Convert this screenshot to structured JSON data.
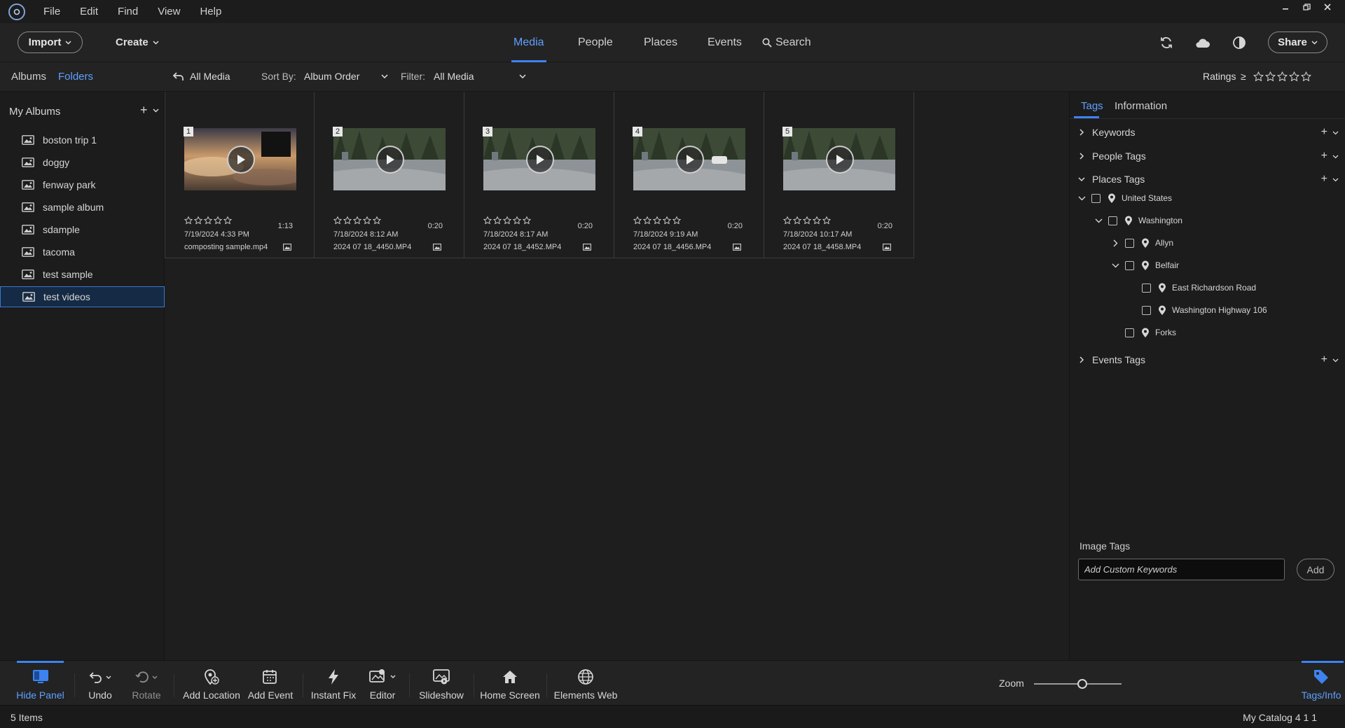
{
  "menu": {
    "items": [
      "File",
      "Edit",
      "Find",
      "View",
      "Help"
    ]
  },
  "toolbar": {
    "import_label": "Import",
    "create_label": "Create",
    "tabs": [
      "Media",
      "People",
      "Places",
      "Events"
    ],
    "active_tab": "Media",
    "search_label": "Search",
    "share_label": "Share"
  },
  "subbar": {
    "albums_tab": "Albums",
    "folders_tab": "Folders",
    "back_label": "All Media",
    "sort_label": "Sort By:",
    "sort_value": "Album Order",
    "filter_label": "Filter:",
    "filter_value": "All Media",
    "ratings_label": "Ratings",
    "ratings_op": "≥"
  },
  "sidebar": {
    "heading": "My Albums",
    "albums": [
      "boston trip 1",
      "doggy",
      "fenway park",
      "sample album",
      "sdample",
      "tacoma",
      "test sample",
      "test videos"
    ],
    "selected": "test videos"
  },
  "media": [
    {
      "index": "1",
      "date": "7/19/2024 4:33 PM",
      "duration": "1:13",
      "filename": "composting sample.mp4",
      "rating": 0
    },
    {
      "index": "2",
      "date": "7/18/2024 8:12 AM",
      "duration": "0:20",
      "filename": "2024 07 18_4450.MP4",
      "rating": 0
    },
    {
      "index": "3",
      "date": "7/18/2024 8:17 AM",
      "duration": "0:20",
      "filename": "2024 07 18_4452.MP4",
      "rating": 0
    },
    {
      "index": "4",
      "date": "7/18/2024 9:19 AM",
      "duration": "0:20",
      "filename": "2024 07 18_4456.MP4",
      "rating": 0
    },
    {
      "index": "5",
      "date": "7/18/2024 10:17 AM",
      "duration": "0:20",
      "filename": "2024 07 18_4458.MP4",
      "rating": 0
    }
  ],
  "right_panel": {
    "tabs": [
      "Tags",
      "Information"
    ],
    "active_tab": "Tags",
    "sections": {
      "keywords": "Keywords",
      "people": "People Tags",
      "places": "Places Tags",
      "events": "Events Tags"
    },
    "places_tree": {
      "country": "United States",
      "state": "Washington",
      "allyn": "Allyn",
      "belfair": "Belfair",
      "road1": "East Richardson Road",
      "road2": "Washington Highway 106",
      "forks": "Forks"
    },
    "image_tags_label": "Image Tags",
    "keyword_placeholder": "Add Custom Keywords",
    "add_label": "Add"
  },
  "bottom_bar": {
    "hide_panel": "Hide Panel",
    "undo": "Undo",
    "rotate": "Rotate",
    "add_location": "Add Location",
    "add_event": "Add Event",
    "instant_fix": "Instant Fix",
    "editor": "Editor",
    "slideshow": "Slideshow",
    "home_screen": "Home Screen",
    "elements_web": "Elements Web",
    "zoom_label": "Zoom",
    "zoom_level": 0.55,
    "tags_info": "Tags/Info"
  },
  "status": {
    "items": "5 Items",
    "catalog": "My Catalog 4 1 1"
  },
  "colors": {
    "accent": "#3d83f0",
    "accent_text": "#5fa0ff",
    "background": "#1e1e1e",
    "panel": "#1c1c1c"
  }
}
